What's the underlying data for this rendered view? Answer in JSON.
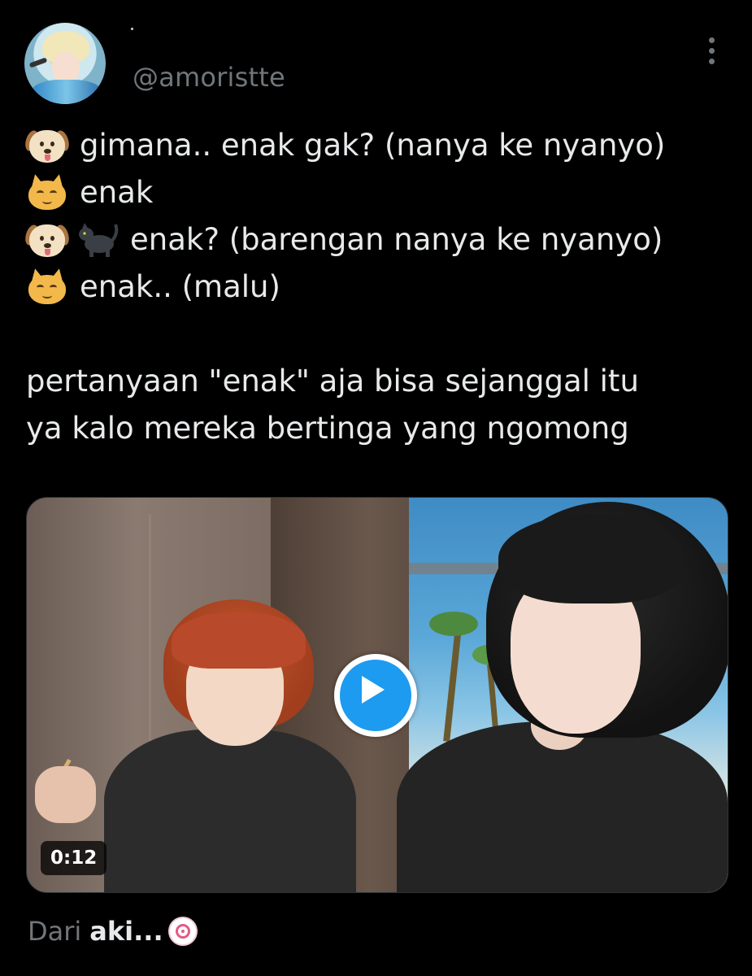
{
  "tweet": {
    "username": "@amoristte",
    "lines": [
      {
        "emojis": [
          "dog-face"
        ],
        "text": "gimana.. enak gak? (nanya ke nyanyo)"
      },
      {
        "emojis": [
          "cat-face"
        ],
        "text": "enak"
      },
      {
        "emojis": [
          "dog-face",
          "black-cat"
        ],
        "text": "enak? (barengan nanya ke nyanyo)"
      },
      {
        "emojis": [
          "cat-face"
        ],
        "text": "enak.. (malu)"
      }
    ],
    "paragraph": [
      "pertanyaan \"enak\" aja bisa sejanggal itu",
      "ya kalo mereka bertinga yang ngomong"
    ],
    "video": {
      "duration": "0:12",
      "play_icon": "play-icon"
    },
    "footer": {
      "prefix": "Dari",
      "source": "aki...",
      "source_icon": "naruto-swirl-icon"
    }
  },
  "colors": {
    "background": "#000000",
    "text": "#e7e9ea",
    "secondary": "#71767b",
    "accent": "#1d9bf0"
  }
}
